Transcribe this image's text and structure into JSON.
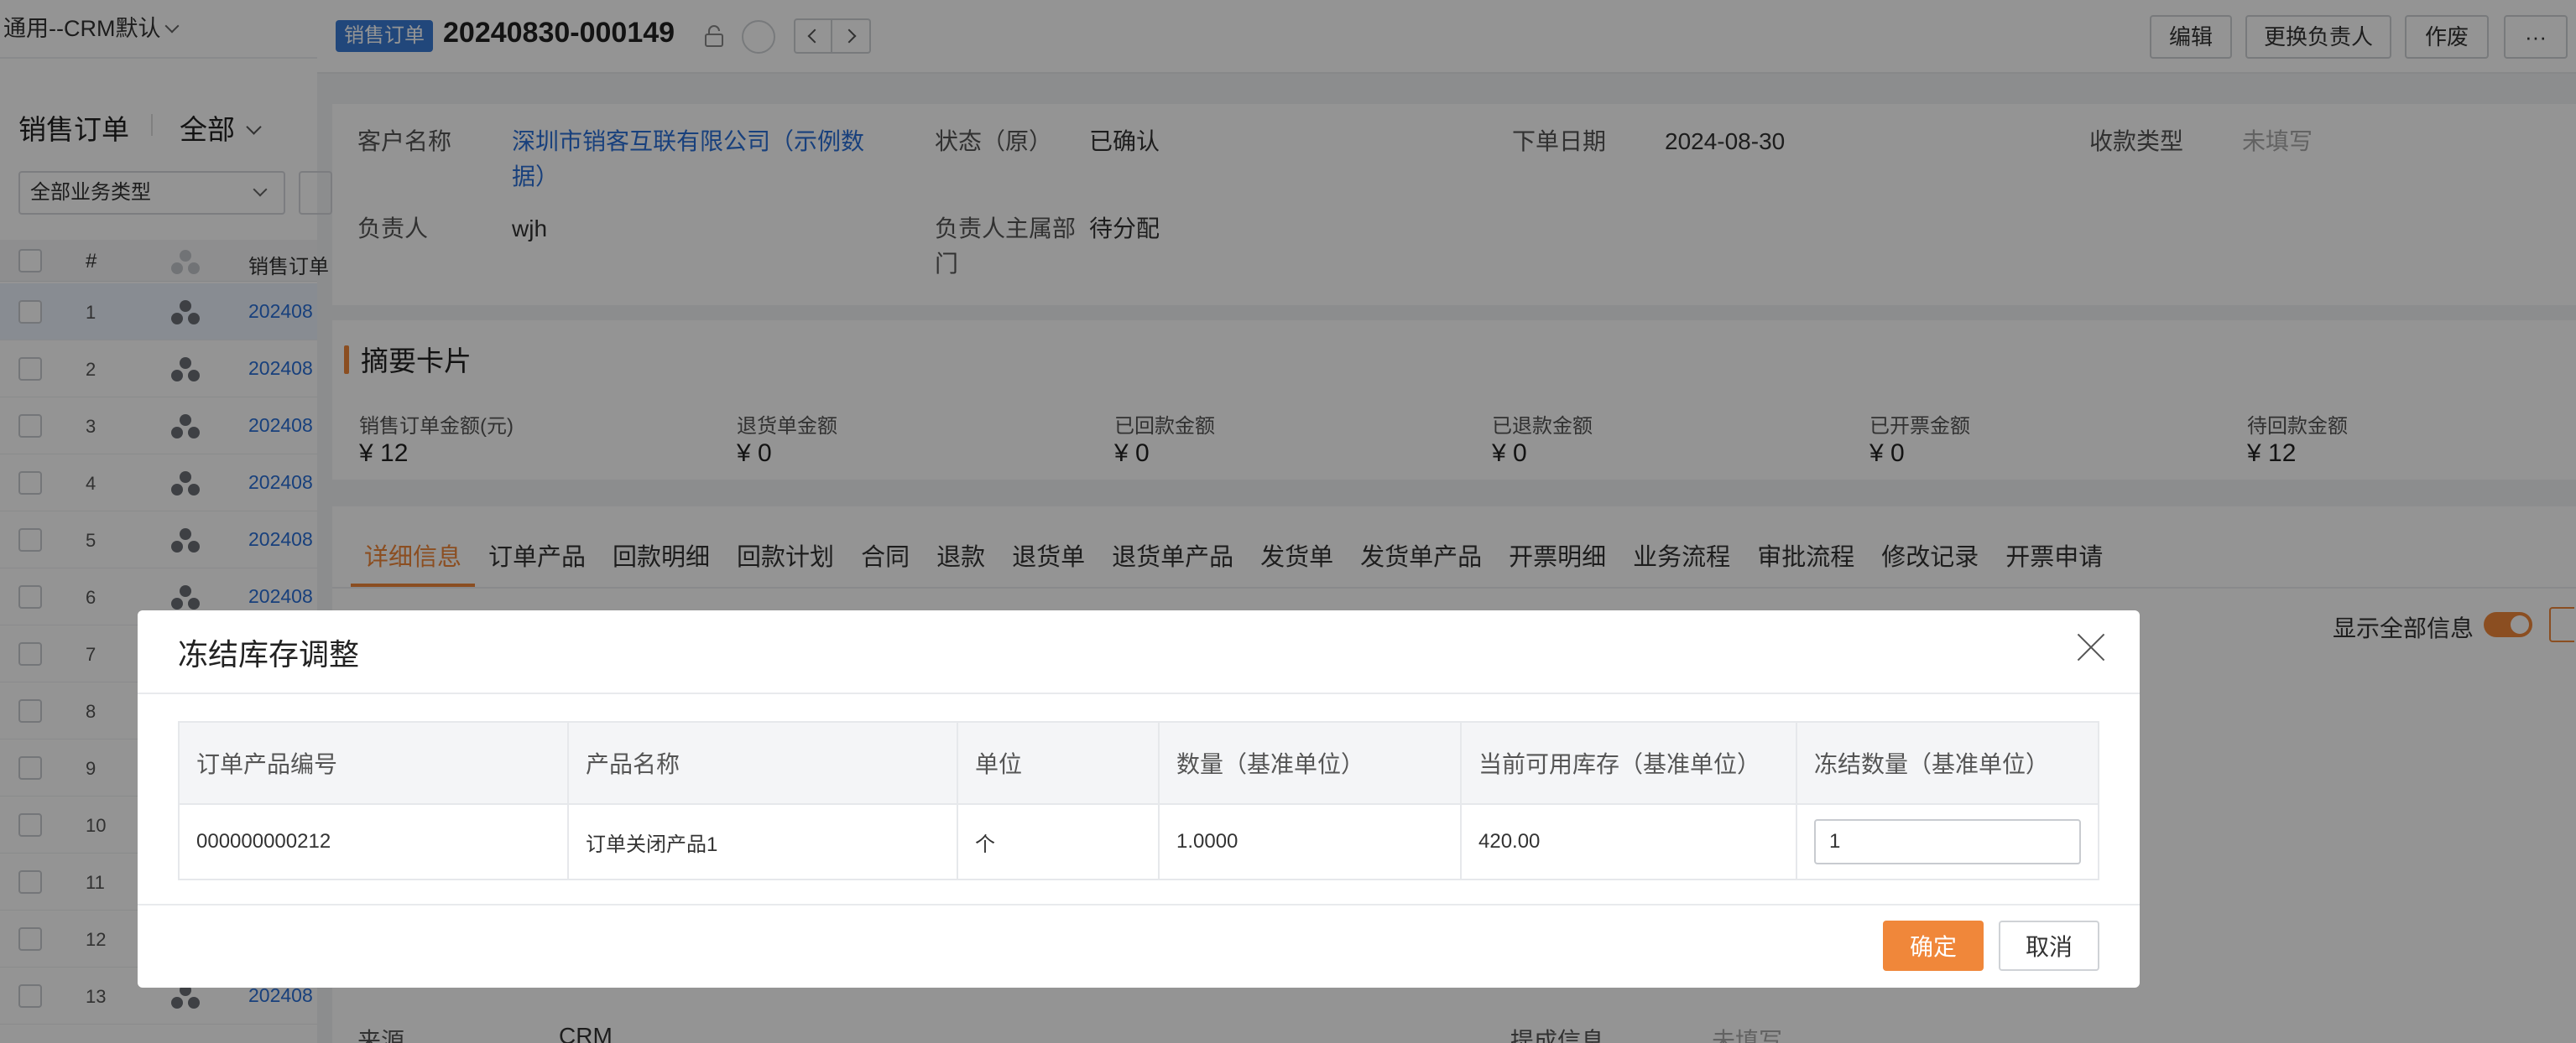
{
  "left_panel": {
    "view_name": "通用--CRM默认",
    "list_title": "销售订单",
    "scope": "全部",
    "type_filter": "全部业务类型",
    "header": {
      "num": "#",
      "col_code": "销售订单"
    },
    "rows": [
      {
        "num": "1",
        "code": "202408",
        "selected": true
      },
      {
        "num": "2",
        "code": "202408"
      },
      {
        "num": "3",
        "code": "202408"
      },
      {
        "num": "4",
        "code": "202408"
      },
      {
        "num": "5",
        "code": "202408"
      },
      {
        "num": "6",
        "code": "202408"
      },
      {
        "num": "7",
        "code": ""
      },
      {
        "num": "8",
        "code": ""
      },
      {
        "num": "9",
        "code": ""
      },
      {
        "num": "10",
        "code": ""
      },
      {
        "num": "11",
        "code": ""
      },
      {
        "num": "12",
        "code": ""
      },
      {
        "num": "13",
        "code": "202408"
      }
    ]
  },
  "header": {
    "badge": "销售订单",
    "order_no": "20240830-000149",
    "actions": {
      "edit": "编辑",
      "change_owner": "更换负责人",
      "void": "作废",
      "more": "···"
    }
  },
  "info": {
    "customer_label": "客户名称",
    "customer_value_1": "深圳市销客互联有限公司（示例数",
    "customer_value_2": "据）",
    "status_label": "状态（原）",
    "status_value": "已确认",
    "order_date_label": "下单日期",
    "order_date_value": "2024-08-30",
    "payment_type_label": "收款类型",
    "payment_type_value": "未填写",
    "owner_label": "负责人",
    "owner_value": "wjh",
    "dept_label_1": "负责人主属部",
    "dept_label_2": "门",
    "dept_value": "待分配"
  },
  "summary": {
    "title": "摘要卡片",
    "items": [
      {
        "label": "销售订单金额(元)",
        "value": "¥ 12"
      },
      {
        "label": "退货单金额",
        "value": "¥ 0"
      },
      {
        "label": "已回款金额",
        "value": "¥ 0"
      },
      {
        "label": "已退款金额",
        "value": "¥ 0"
      },
      {
        "label": "已开票金额",
        "value": "¥ 0"
      },
      {
        "label": "待回款金额",
        "value": "¥ 12"
      }
    ]
  },
  "tabs": [
    "详细信息",
    "订单产品",
    "回款明细",
    "回款计划",
    "合同",
    "退款",
    "退货单",
    "退货单产品",
    "发货单",
    "发货单产品",
    "开票明细",
    "业务流程",
    "审批流程",
    "修改记录",
    "开票申请"
  ],
  "show_all_label": "显示全部信息",
  "bottom": {
    "source_label": "来源",
    "source_value": "CRM",
    "reminder_label": "提成信息",
    "reminder_value": "未填写"
  },
  "modal": {
    "title": "冻结库存调整",
    "columns": [
      "订单产品编号",
      "产品名称",
      "单位",
      "数量（基准单位）",
      "当前可用库存（基准单位）",
      "冻结数量（基准单位）"
    ],
    "row": {
      "code": "000000000212",
      "name": "订单关闭产品1",
      "unit": "个",
      "qty": "1.0000",
      "stock": "420.00",
      "freeze_qty": "1"
    },
    "ok_label": "确定",
    "cancel_label": "取消"
  },
  "colors": {
    "accent": "#f0873a",
    "link": "#2a6fd6",
    "badge": "#3a7bd5"
  }
}
